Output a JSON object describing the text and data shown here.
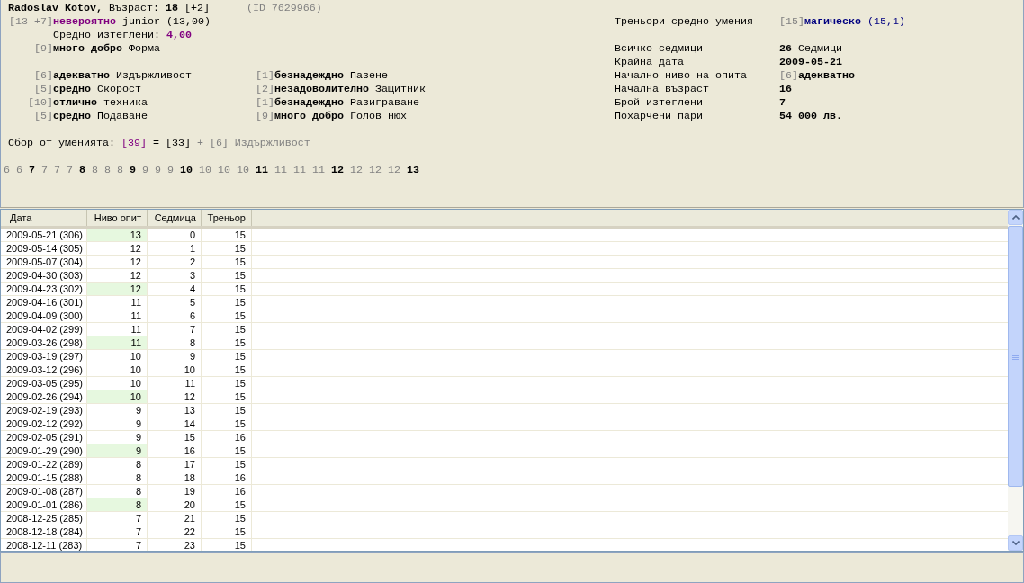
{
  "player": {
    "name": "Radoslav Kotov,",
    "age_label": "Възраст:",
    "age": "18",
    "age_bonus": "[+2]",
    "id": "(ID 7629966)"
  },
  "experience": {
    "score": "[13 +7]",
    "rating": "невероятно",
    "text": "junior (13,00)"
  },
  "average_pulls": {
    "label": "Средно изтеглени:",
    "value": "4,00"
  },
  "form": {
    "score": "[9]",
    "rating": "много добро",
    "name": "Форма"
  },
  "skill_rows": [
    [
      {
        "score": "[6]",
        "rating": "адекватно",
        "name": "Издържливост"
      },
      {
        "score": "[1]",
        "rating": "безнадеждно",
        "name": "Пазене"
      }
    ],
    [
      {
        "score": "[5]",
        "rating": "средно",
        "name": "Скорост"
      },
      {
        "score": "[2]",
        "rating": "незадоволително",
        "name": "Защитник"
      }
    ],
    [
      {
        "score": "[10]",
        "rating": "отлично",
        "name": "техника"
      },
      {
        "score": "[1]",
        "rating": "безнадеждно",
        "name": "Разиграване"
      }
    ],
    [
      {
        "score": "[5]",
        "rating": "средно",
        "name": "Подаване"
      },
      {
        "score": "[9]",
        "rating": "много добро",
        "name": "Голов нюх"
      }
    ]
  ],
  "stats": [
    {
      "label": "Треньори средно умения",
      "kind": "highlight",
      "score": "[15]",
      "value": "магическо",
      "unit": "(15,1)"
    },
    {
      "label": "Всичко седмици",
      "kind": "plain",
      "value": "26",
      "unit": "Седмици"
    },
    {
      "label": "Крайна дата",
      "kind": "plain",
      "value": "2009-05-21"
    },
    {
      "label": "Начално ниво на опита",
      "kind": "plain",
      "score": "[6]",
      "value": "адекватно"
    },
    {
      "label": "Начална възраст",
      "kind": "plain",
      "value": "16"
    },
    {
      "label": "Брой изтеглени",
      "kind": "plain",
      "value": "7"
    },
    {
      "label": "Похарчени пари",
      "kind": "plain",
      "value": "54 000 лв."
    }
  ],
  "skill_total": {
    "label": "Сбор от уменията:",
    "total": "[39]",
    "base": "= [33]",
    "bonus": "+ [6] Издържливост"
  },
  "level_history": [
    {
      "value": "6",
      "emphasis": false
    },
    {
      "value": "6",
      "emphasis": false
    },
    {
      "value": "7",
      "emphasis": true
    },
    {
      "value": "7",
      "emphasis": false
    },
    {
      "value": "7",
      "emphasis": false
    },
    {
      "value": "7",
      "emphasis": false
    },
    {
      "value": "8",
      "emphasis": true
    },
    {
      "value": "8",
      "emphasis": false
    },
    {
      "value": "8",
      "emphasis": false
    },
    {
      "value": "8",
      "emphasis": false
    },
    {
      "value": "9",
      "emphasis": true
    },
    {
      "value": "9",
      "emphasis": false
    },
    {
      "value": "9",
      "emphasis": false
    },
    {
      "value": "9",
      "emphasis": false
    },
    {
      "value": "10",
      "emphasis": true
    },
    {
      "value": "10",
      "emphasis": false
    },
    {
      "value": "10",
      "emphasis": false
    },
    {
      "value": "10",
      "emphasis": false
    },
    {
      "value": "11",
      "emphasis": true
    },
    {
      "value": "11",
      "emphasis": false
    },
    {
      "value": "11",
      "emphasis": false
    },
    {
      "value": "11",
      "emphasis": false
    },
    {
      "value": "12",
      "emphasis": true
    },
    {
      "value": "12",
      "emphasis": false
    },
    {
      "value": "12",
      "emphasis": false
    },
    {
      "value": "12",
      "emphasis": false
    },
    {
      "value": "13",
      "emphasis": true
    }
  ],
  "table": {
    "columns": [
      "Дата",
      "Ниво опит",
      "Седмица",
      "Треньор"
    ],
    "rows": [
      {
        "date": "2009-05-21 (306)",
        "experience": "13",
        "week": "0",
        "trainer": "15",
        "highlighted": true
      },
      {
        "date": "2009-05-14 (305)",
        "experience": "12",
        "week": "1",
        "trainer": "15",
        "highlighted": false
      },
      {
        "date": "2009-05-07 (304)",
        "experience": "12",
        "week": "2",
        "trainer": "15",
        "highlighted": false
      },
      {
        "date": "2009-04-30 (303)",
        "experience": "12",
        "week": "3",
        "trainer": "15",
        "highlighted": false
      },
      {
        "date": "2009-04-23 (302)",
        "experience": "12",
        "week": "4",
        "trainer": "15",
        "highlighted": true
      },
      {
        "date": "2009-04-16 (301)",
        "experience": "11",
        "week": "5",
        "trainer": "15",
        "highlighted": false
      },
      {
        "date": "2009-04-09 (300)",
        "experience": "11",
        "week": "6",
        "trainer": "15",
        "highlighted": false
      },
      {
        "date": "2009-04-02 (299)",
        "experience": "11",
        "week": "7",
        "trainer": "15",
        "highlighted": false
      },
      {
        "date": "2009-03-26 (298)",
        "experience": "11",
        "week": "8",
        "trainer": "15",
        "highlighted": true
      },
      {
        "date": "2009-03-19 (297)",
        "experience": "10",
        "week": "9",
        "trainer": "15",
        "highlighted": false
      },
      {
        "date": "2009-03-12 (296)",
        "experience": "10",
        "week": "10",
        "trainer": "15",
        "highlighted": false
      },
      {
        "date": "2009-03-05 (295)",
        "experience": "10",
        "week": "11",
        "trainer": "15",
        "highlighted": false
      },
      {
        "date": "2009-02-26 (294)",
        "experience": "10",
        "week": "12",
        "trainer": "15",
        "highlighted": true
      },
      {
        "date": "2009-02-19 (293)",
        "experience": "9",
        "week": "13",
        "trainer": "15",
        "highlighted": false
      },
      {
        "date": "2009-02-12 (292)",
        "experience": "9",
        "week": "14",
        "trainer": "15",
        "highlighted": false
      },
      {
        "date": "2009-02-05 (291)",
        "experience": "9",
        "week": "15",
        "trainer": "16",
        "highlighted": false
      },
      {
        "date": "2009-01-29 (290)",
        "experience": "9",
        "week": "16",
        "trainer": "15",
        "highlighted": true
      },
      {
        "date": "2009-01-22 (289)",
        "experience": "8",
        "week": "17",
        "trainer": "15",
        "highlighted": false
      },
      {
        "date": "2009-01-15 (288)",
        "experience": "8",
        "week": "18",
        "trainer": "16",
        "highlighted": false
      },
      {
        "date": "2009-01-08 (287)",
        "experience": "8",
        "week": "19",
        "trainer": "16",
        "highlighted": false
      },
      {
        "date": "2009-01-01 (286)",
        "experience": "8",
        "week": "20",
        "trainer": "15",
        "highlighted": true
      },
      {
        "date": "2008-12-25 (285)",
        "experience": "7",
        "week": "21",
        "trainer": "15",
        "highlighted": false
      },
      {
        "date": "2008-12-18 (284)",
        "experience": "7",
        "week": "22",
        "trainer": "15",
        "highlighted": false
      },
      {
        "date": "2008-12-11 (283)",
        "experience": "7",
        "week": "23",
        "trainer": "15",
        "highlighted": false
      }
    ]
  }
}
